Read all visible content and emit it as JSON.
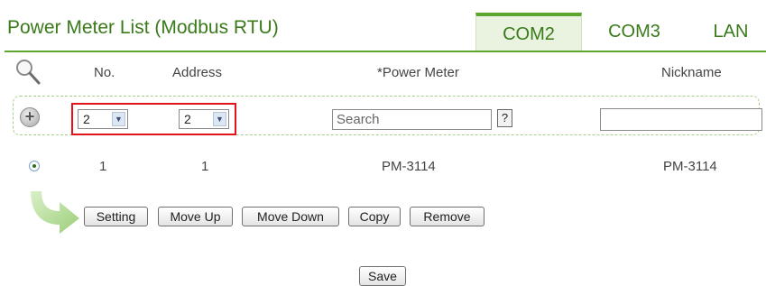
{
  "header": {
    "title": "Power Meter List (Modbus RTU)",
    "tabs": [
      {
        "label": "COM2",
        "active": true
      },
      {
        "label": "COM3",
        "active": false
      },
      {
        "label": "LAN",
        "active": false
      }
    ]
  },
  "columns": {
    "search_icon": "magnifier-icon",
    "no": "No.",
    "address": "Address",
    "power_meter": "*Power Meter",
    "nickname": "Nickname"
  },
  "add_row": {
    "add_icon": "plus-circle-icon",
    "no_select": "2",
    "address_select": "2",
    "search_placeholder": "Search",
    "help_label": "?",
    "nickname_value": ""
  },
  "rows": [
    {
      "selected": true,
      "no": "1",
      "address": "1",
      "power_meter": "PM-3114",
      "nickname": "PM-3114"
    }
  ],
  "actions": {
    "setting": "Setting",
    "move_up": "Move Up",
    "move_down": "Move Down",
    "copy": "Copy",
    "remove": "Remove",
    "save": "Save"
  },
  "colors": {
    "accent_green": "#5ba62d",
    "title_green": "#3a7a1a",
    "highlight_red": "#e2141b"
  }
}
